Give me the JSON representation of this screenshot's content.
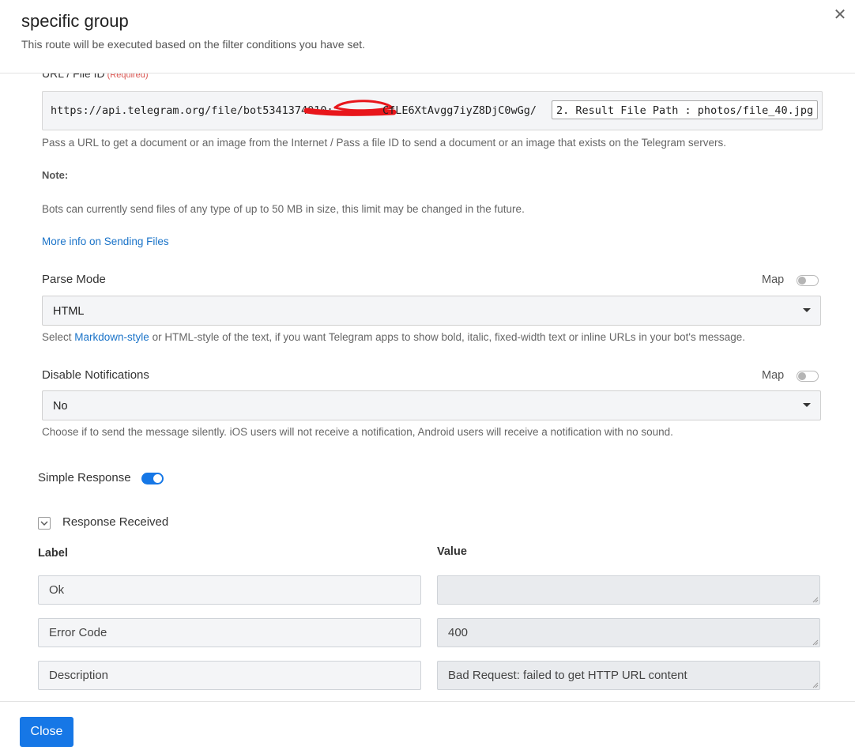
{
  "header": {
    "title": "specific group",
    "subtitle": "This route will be executed based on the filter conditions you have set."
  },
  "url_field": {
    "label": "URL / File ID",
    "required": "(Required)",
    "prefix": "https://api.telegram.org/file/bot5341374010:",
    "suffix": "CfLE6XtAvgg7iyZ8DjC0wGg/",
    "token": "2. Result File Path : photos/file_40.jpg",
    "help": "Pass a URL to get a document or an image from the Internet / Pass a file ID to send a document or an image that exists on the Telegram servers."
  },
  "note": {
    "label": "Note:",
    "text": "Bots can currently send files of any type of up to 50 MB in size, this limit may be changed in the future.",
    "link": "More info on Sending Files"
  },
  "parse_mode": {
    "label": "Parse Mode",
    "map_label": "Map",
    "value": "HTML",
    "help_prefix": "Select ",
    "help_link": "Markdown-style",
    "help_suffix": " or HTML-style of the text, if you want Telegram apps to show bold, italic, fixed-width text or inline URLs in your bot's message."
  },
  "disable_notifications": {
    "label": "Disable Notifications",
    "map_label": "Map",
    "value": "No",
    "help": "Choose if to send the message silently. iOS users will not receive a notification, Android users will receive a notification with no sound."
  },
  "simple_response": {
    "label": "Simple Response"
  },
  "response": {
    "toggle_label": "Response Received",
    "col_label": "Label",
    "col_value": "Value",
    "rows": [
      {
        "label": "Ok",
        "value": ""
      },
      {
        "label": "Error Code",
        "value": "400"
      },
      {
        "label": "Description",
        "value": "Bad Request: failed to get HTTP URL content"
      }
    ]
  },
  "footer": {
    "close_label": "Close"
  },
  "colors": {
    "primary": "#1677e6",
    "link": "#1a73c8",
    "required": "#d9534f",
    "redaction": "#e8161b"
  }
}
